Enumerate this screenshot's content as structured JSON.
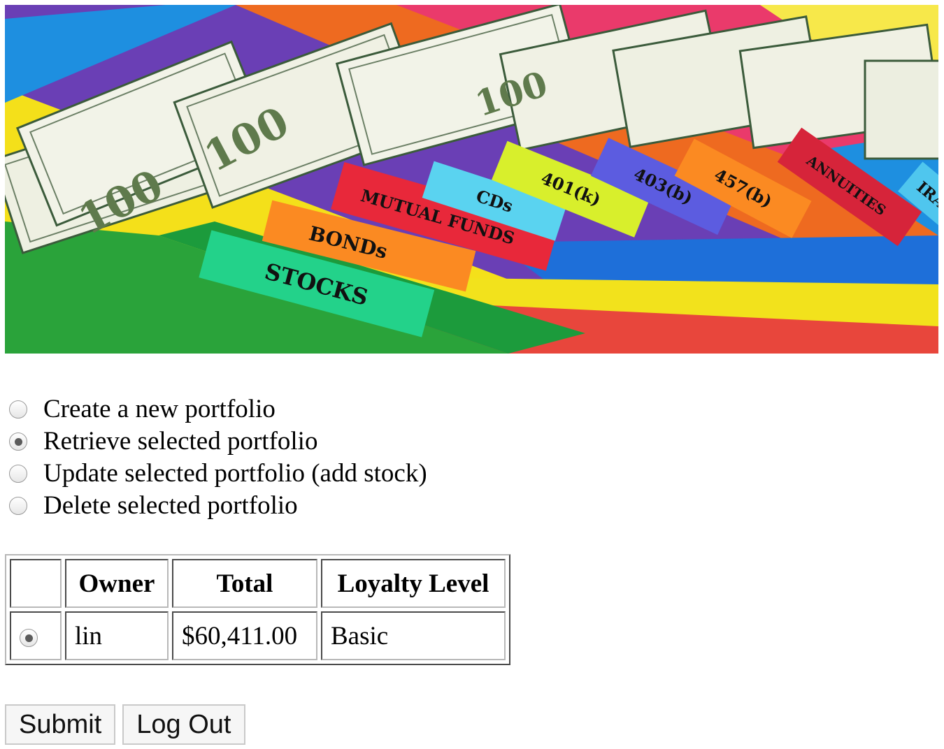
{
  "banner": {
    "tabs": [
      "STOCKS",
      "BONDs",
      "MUTUAL FUNDS",
      "CDs",
      "401(k)",
      "403(b)",
      "457(b)",
      "ANNUITIES",
      "IRA"
    ],
    "bill_denomination": "100"
  },
  "actions": {
    "options": [
      {
        "label": "Create a new portfolio",
        "checked": false
      },
      {
        "label": "Retrieve selected portfolio",
        "checked": true
      },
      {
        "label": "Update selected portfolio (add stock)",
        "checked": false
      },
      {
        "label": "Delete selected portfolio",
        "checked": false
      }
    ]
  },
  "table": {
    "headers": [
      "",
      "Owner",
      "Total",
      "Loyalty Level"
    ],
    "rows": [
      {
        "selected": true,
        "owner": "lin",
        "total": "$60,411.00",
        "loyalty": "Basic"
      }
    ]
  },
  "buttons": {
    "submit": "Submit",
    "logout": "Log Out"
  }
}
